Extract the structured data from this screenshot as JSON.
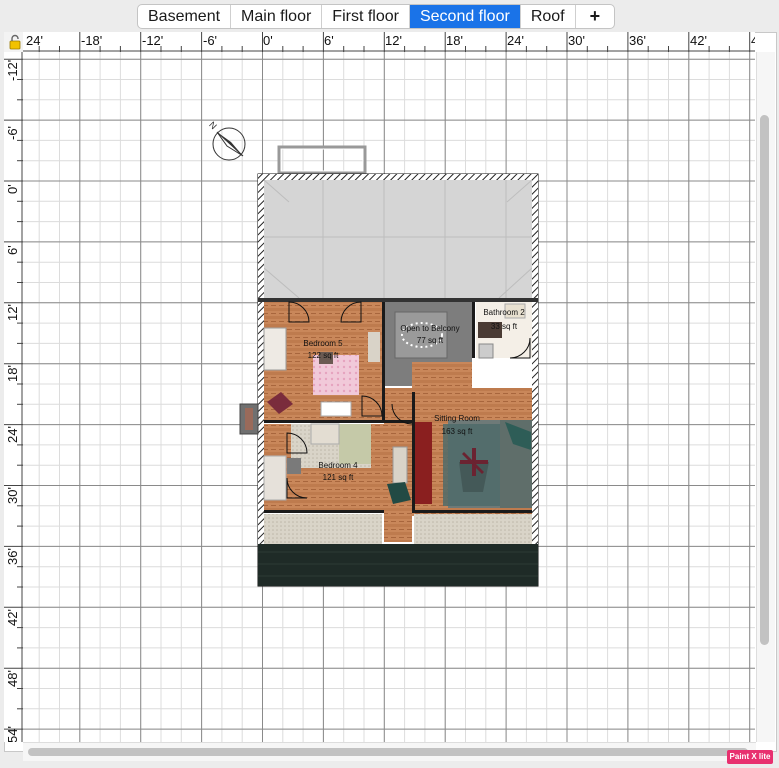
{
  "tabs": [
    {
      "label": "Basement"
    },
    {
      "label": "Main floor"
    },
    {
      "label": "First floor"
    },
    {
      "label": "Second floor"
    },
    {
      "label": "Roof"
    },
    {
      "label": "+"
    }
  ],
  "ruler": {
    "top_labels": [
      "24'",
      "-18'",
      "-12'",
      "-6'",
      "0'",
      "6'",
      "12'",
      "18'",
      "24'",
      "30'",
      "36'",
      "42'",
      "4"
    ],
    "left_labels": [
      "-12'",
      "-6'",
      "0'",
      "6'",
      "12'",
      "18'",
      "24'",
      "30'",
      "36'",
      "42'",
      "48'",
      "54'"
    ]
  },
  "rooms": [
    {
      "name": "Bedroom 5",
      "area": "122 sq ft"
    },
    {
      "name": "Open to Balcony",
      "area": "77 sq ft"
    },
    {
      "name": "Bathroom 2",
      "area": "33 sq ft"
    },
    {
      "name": "Sitting Room",
      "area": "163 sq ft"
    },
    {
      "name": "Bedroom 4",
      "area": "121 sq ft"
    }
  ],
  "compass": {
    "label": "N"
  },
  "badge": {
    "text": "Paint X lite"
  },
  "icons": {
    "lock": "lock-icon",
    "compass": "compass-icon",
    "add": "plus-icon"
  }
}
